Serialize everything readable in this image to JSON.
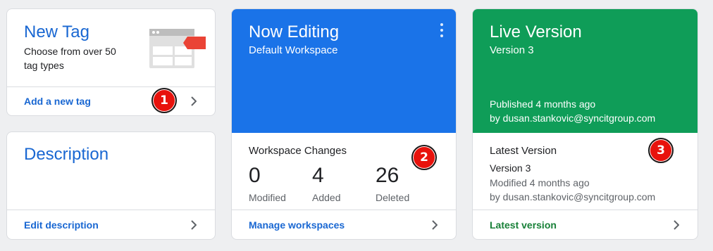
{
  "new_tag_card": {
    "title": "New Tag",
    "description": "Choose from over 50 tag types",
    "footer_link": "Add a new tag",
    "badge": "1"
  },
  "description_card": {
    "title": "Description",
    "footer_link": "Edit description"
  },
  "now_editing_card": {
    "title": "Now Editing",
    "workspace": "Default Workspace",
    "changes_label": "Workspace Changes",
    "stats": [
      {
        "value": "0",
        "label": "Modified"
      },
      {
        "value": "4",
        "label": "Added"
      },
      {
        "value": "26",
        "label": "Deleted"
      }
    ],
    "footer_link": "Manage workspaces",
    "badge": "2",
    "hero_color": "#1a73e8"
  },
  "live_version_card": {
    "title": "Live Version",
    "version": "Version 3",
    "published": "Published 4 months ago",
    "published_by": "by dusan.stankovic@syncitgroup.com",
    "latest_label": "Latest Version",
    "latest_version": "Version 3",
    "modified": "Modified 4 months ago",
    "modified_by": "by dusan.stankovic@syncitgroup.com",
    "footer_link": "Latest version",
    "badge": "3",
    "hero_color": "#0f9d58"
  },
  "icons": [
    "tag-illustration-icon",
    "chevron-right-icon",
    "more-vert-icon"
  ]
}
